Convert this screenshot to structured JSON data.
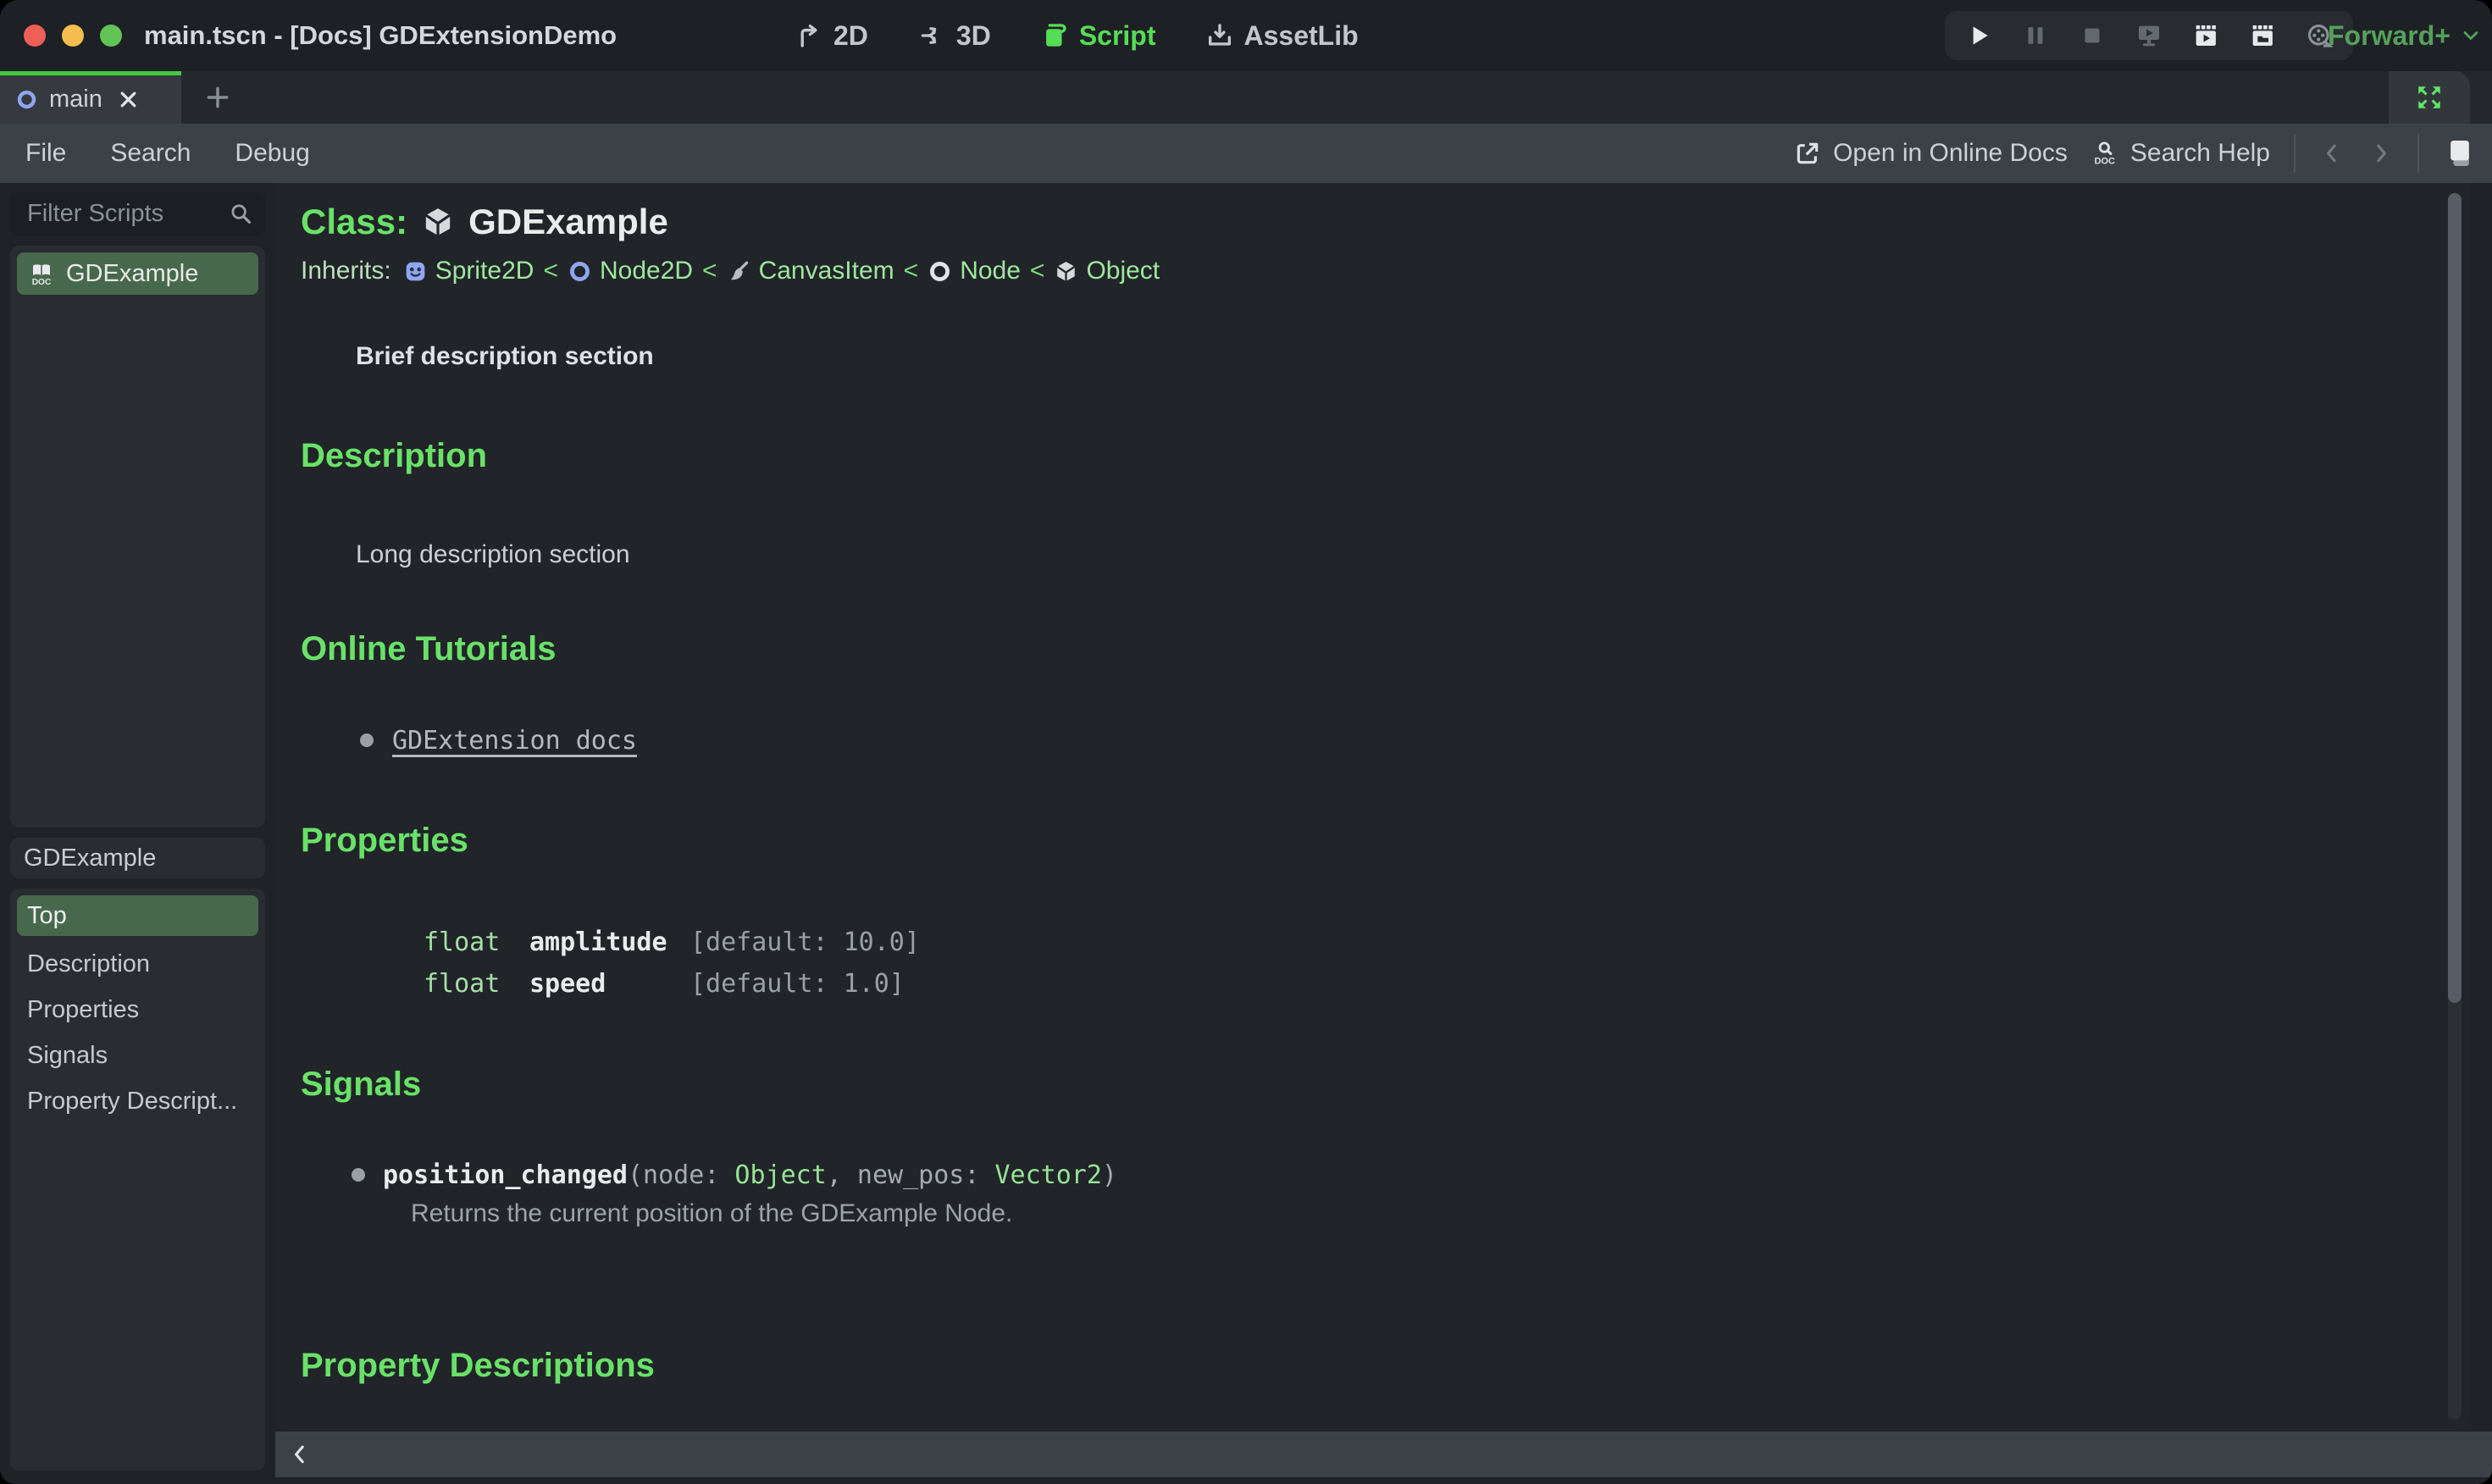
{
  "colors": {
    "accent_green": "#69e169",
    "link_green": "#9fe6a0",
    "selected_green": "#47684c",
    "tab_active_line": "#41c941",
    "workspace_active_green": "#55dd55",
    "renderer_green": "#56a05c",
    "doc_background": "#212428",
    "menubar_background": "#3c4147"
  },
  "titlebar": {
    "title": "main.tscn - [Docs] GDExtensionDemo",
    "workspaces": [
      {
        "label": "2D",
        "icon": "workspace-2d-icon",
        "active": false
      },
      {
        "label": "3D",
        "icon": "workspace-3d-icon",
        "active": false
      },
      {
        "label": "Script",
        "icon": "workspace-script-icon",
        "active": true
      },
      {
        "label": "AssetLib",
        "icon": "workspace-assetlib-icon",
        "active": false
      }
    ],
    "playback_icons": [
      "play-icon",
      "pause-icon",
      "stop-icon",
      "play-scene-icon",
      "play-current-scene-icon",
      "play-custom-scene-icon",
      "movie-maker-icon"
    ],
    "renderer": "Forward+"
  },
  "scene_tabs": {
    "active_tab": "main",
    "active_tab_icon": "node2d-icon"
  },
  "menubar": {
    "items": [
      "File",
      "Search",
      "Debug"
    ],
    "open_online_docs": "Open in Online Docs",
    "search_help": "Search Help"
  },
  "sidebar": {
    "filter_placeholder": "Filter Scripts",
    "scripts": [
      {
        "label": "GDExample",
        "icon": "doc-book-icon",
        "selected": true
      }
    ],
    "member_header": "GDExample",
    "members": [
      {
        "label": "Top",
        "selected": true
      },
      {
        "label": "Description",
        "selected": false
      },
      {
        "label": "Properties",
        "selected": false
      },
      {
        "label": "Signals",
        "selected": false
      },
      {
        "label": "Property Descript...",
        "selected": false
      }
    ]
  },
  "doc": {
    "class_label": "Class:",
    "class_name": "GDExample",
    "class_icon": "object-icon",
    "inherits_label": "Inherits:",
    "separator": "<",
    "inherits_chain": [
      {
        "name": "Sprite2D",
        "icon": "sprite2d-icon"
      },
      {
        "name": "Node2D",
        "icon": "node2d-icon"
      },
      {
        "name": "CanvasItem",
        "icon": "canvasitem-icon"
      },
      {
        "name": "Node",
        "icon": "node-icon"
      },
      {
        "name": "Object",
        "icon": "object-icon"
      }
    ],
    "brief": "Brief description section",
    "headings": {
      "description": "Description",
      "tutorials": "Online Tutorials",
      "properties": "Properties",
      "signals": "Signals",
      "property_descriptions": "Property Descriptions"
    },
    "description_text": "Long description section",
    "tutorial_link": "GDExtension docs",
    "properties": [
      {
        "type": "float",
        "name": "amplitude",
        "default": "[default: 10.0]"
      },
      {
        "type": "float",
        "name": "speed",
        "default": "[default: 1.0]"
      }
    ],
    "signal": {
      "name": "position_changed",
      "sig_open": "(",
      "param1_label": "node: ",
      "param1_type": "Object",
      "sig_sep": ", ",
      "param2_label": "new_pos: ",
      "param2_type": "Vector2",
      "sig_close": ")",
      "description": "Returns the current position of the GDExample Node."
    }
  }
}
